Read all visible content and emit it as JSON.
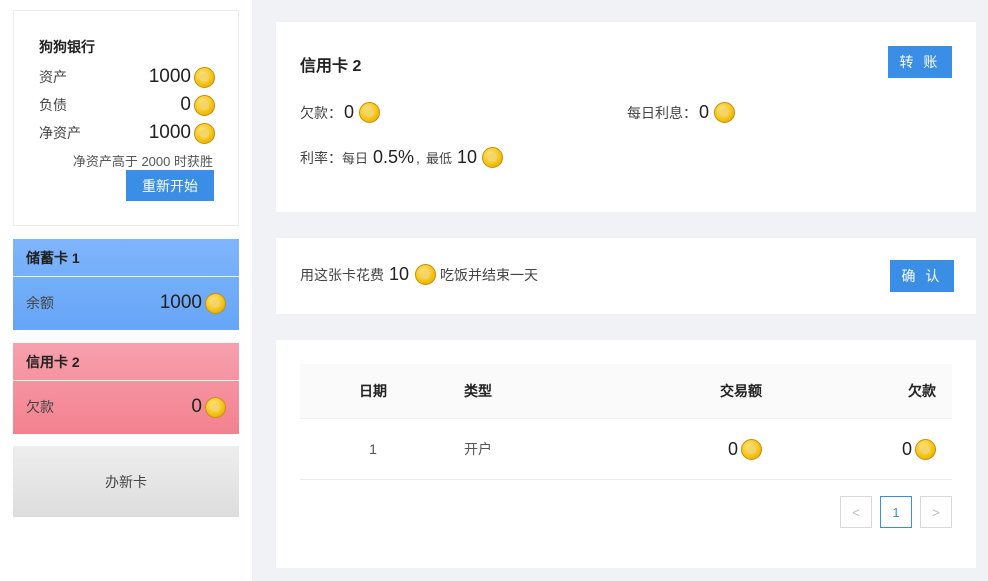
{
  "sidebar": {
    "bank": {
      "title": "狗狗银行",
      "assets_label": "资产",
      "assets_value": "1000",
      "liabilities_label": "负债",
      "liabilities_value": "0",
      "net_label": "净资产",
      "net_value": "1000",
      "win_note": "净资产高于 2000 时获胜",
      "restart_label": "重新开始"
    },
    "debit_card": {
      "title": "储蓄卡 1",
      "label": "余额",
      "value": "1000"
    },
    "credit_card": {
      "title": "信用卡 2",
      "label": "欠款",
      "value": "0"
    },
    "new_card_label": "办新卡"
  },
  "info": {
    "title": "信用卡 2",
    "transfer_label": "转 账",
    "debt_label": "欠款：",
    "debt_value": "0",
    "daily_interest_label": "每日利息：",
    "daily_interest_value": "0",
    "rate_label": "利率：",
    "rate_prefix": "每日",
    "rate_value": "0.5%",
    "rate_sep": ",",
    "min_label": "最低",
    "min_value": "10"
  },
  "action": {
    "text_prefix": "用这张卡花费",
    "amount": "10",
    "text_suffix": "吃饭并结束一天",
    "confirm_label": "确 认"
  },
  "table": {
    "headers": {
      "date": "日期",
      "type": "类型",
      "amount": "交易额",
      "debt": "欠款"
    },
    "rows": [
      {
        "date": "1",
        "type": "开户",
        "amount": "0",
        "debt": "0"
      }
    ],
    "pager": {
      "prev": "<",
      "page": "1",
      "next": ">"
    }
  },
  "colors": {
    "primary": "#3a8ee6",
    "debit_card": "#74aefa",
    "credit_card": "#f58f9d",
    "coin": "#f5c518"
  },
  "icons": {
    "coin": "coin-icon",
    "prev": "chevron-left-icon",
    "next": "chevron-right-icon"
  }
}
